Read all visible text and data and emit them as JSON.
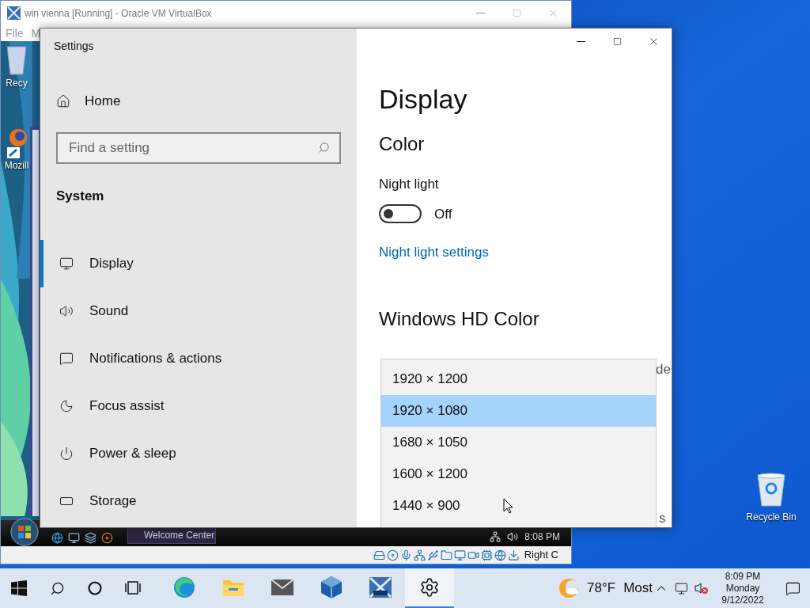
{
  "vbox": {
    "title": "win vienna [Running] - Oracle VM VirtualBox",
    "menu": [
      "File",
      "M"
    ],
    "status_text": "Right C"
  },
  "guest_desktop": {
    "icons": [
      "Recy",
      "Mozill"
    ]
  },
  "guest_taskbar": {
    "task": "Welcome Center",
    "clock": "8:08 PM"
  },
  "settings": {
    "title": "Settings",
    "home": "Home",
    "search_placeholder": "Find a setting",
    "section": "System",
    "nav": [
      {
        "kind": "display",
        "label": "Display",
        "selected": true
      },
      {
        "kind": "sound",
        "label": "Sound",
        "selected": false
      },
      {
        "kind": "notifications",
        "label": "Notifications & actions",
        "selected": false
      },
      {
        "kind": "focus",
        "label": "Focus assist",
        "selected": false
      },
      {
        "kind": "power",
        "label": "Power & sleep",
        "selected": false
      },
      {
        "kind": "storage",
        "label": "Storage",
        "selected": false
      }
    ],
    "page_title": "Display",
    "color_heading": "Color",
    "night_light": {
      "label": "Night light",
      "on": false,
      "state_text": "Off"
    },
    "link": "Night light settings",
    "hd_heading": "Windows HD Color",
    "partial_texts": [
      "de",
      "s"
    ]
  },
  "dropdown": {
    "options": [
      {
        "label": "1920 × 1200",
        "selected": false
      },
      {
        "label": "1920 × 1080",
        "selected": true
      },
      {
        "label": "1680 × 1050",
        "selected": false
      },
      {
        "label": "1600 × 1200",
        "selected": false
      },
      {
        "label": "1440 × 900",
        "selected": false
      }
    ]
  },
  "host_desktop": {
    "icons": [
      "Recycle Bin"
    ]
  },
  "taskbar": {
    "apps": [
      {
        "kind": "edge",
        "selected": false
      },
      {
        "kind": "explorer",
        "selected": false
      },
      {
        "kind": "mail",
        "selected": false
      },
      {
        "kind": "virtualbox",
        "selected": false
      },
      {
        "kind": "vista",
        "selected": false
      },
      {
        "kind": "settings",
        "selected": true
      }
    ],
    "weather": {
      "temp": "78°F",
      "text": "Most"
    },
    "clock": {
      "time": "8:09 PM",
      "day": "Monday",
      "date": "9/12/2022"
    }
  }
}
